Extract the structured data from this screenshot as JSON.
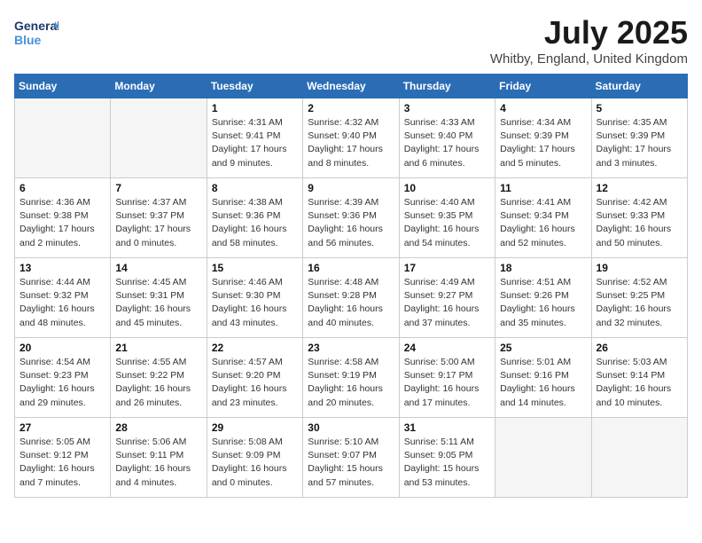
{
  "logo": {
    "line1": "General",
    "line2": "Blue"
  },
  "title": "July 2025",
  "location": "Whitby, England, United Kingdom",
  "weekdays": [
    "Sunday",
    "Monday",
    "Tuesday",
    "Wednesday",
    "Thursday",
    "Friday",
    "Saturday"
  ],
  "weeks": [
    [
      {
        "day": "",
        "info": ""
      },
      {
        "day": "",
        "info": ""
      },
      {
        "day": "1",
        "info": "Sunrise: 4:31 AM\nSunset: 9:41 PM\nDaylight: 17 hours and 9 minutes."
      },
      {
        "day": "2",
        "info": "Sunrise: 4:32 AM\nSunset: 9:40 PM\nDaylight: 17 hours and 8 minutes."
      },
      {
        "day": "3",
        "info": "Sunrise: 4:33 AM\nSunset: 9:40 PM\nDaylight: 17 hours and 6 minutes."
      },
      {
        "day": "4",
        "info": "Sunrise: 4:34 AM\nSunset: 9:39 PM\nDaylight: 17 hours and 5 minutes."
      },
      {
        "day": "5",
        "info": "Sunrise: 4:35 AM\nSunset: 9:39 PM\nDaylight: 17 hours and 3 minutes."
      }
    ],
    [
      {
        "day": "6",
        "info": "Sunrise: 4:36 AM\nSunset: 9:38 PM\nDaylight: 17 hours and 2 minutes."
      },
      {
        "day": "7",
        "info": "Sunrise: 4:37 AM\nSunset: 9:37 PM\nDaylight: 17 hours and 0 minutes."
      },
      {
        "day": "8",
        "info": "Sunrise: 4:38 AM\nSunset: 9:36 PM\nDaylight: 16 hours and 58 minutes."
      },
      {
        "day": "9",
        "info": "Sunrise: 4:39 AM\nSunset: 9:36 PM\nDaylight: 16 hours and 56 minutes."
      },
      {
        "day": "10",
        "info": "Sunrise: 4:40 AM\nSunset: 9:35 PM\nDaylight: 16 hours and 54 minutes."
      },
      {
        "day": "11",
        "info": "Sunrise: 4:41 AM\nSunset: 9:34 PM\nDaylight: 16 hours and 52 minutes."
      },
      {
        "day": "12",
        "info": "Sunrise: 4:42 AM\nSunset: 9:33 PM\nDaylight: 16 hours and 50 minutes."
      }
    ],
    [
      {
        "day": "13",
        "info": "Sunrise: 4:44 AM\nSunset: 9:32 PM\nDaylight: 16 hours and 48 minutes."
      },
      {
        "day": "14",
        "info": "Sunrise: 4:45 AM\nSunset: 9:31 PM\nDaylight: 16 hours and 45 minutes."
      },
      {
        "day": "15",
        "info": "Sunrise: 4:46 AM\nSunset: 9:30 PM\nDaylight: 16 hours and 43 minutes."
      },
      {
        "day": "16",
        "info": "Sunrise: 4:48 AM\nSunset: 9:28 PM\nDaylight: 16 hours and 40 minutes."
      },
      {
        "day": "17",
        "info": "Sunrise: 4:49 AM\nSunset: 9:27 PM\nDaylight: 16 hours and 37 minutes."
      },
      {
        "day": "18",
        "info": "Sunrise: 4:51 AM\nSunset: 9:26 PM\nDaylight: 16 hours and 35 minutes."
      },
      {
        "day": "19",
        "info": "Sunrise: 4:52 AM\nSunset: 9:25 PM\nDaylight: 16 hours and 32 minutes."
      }
    ],
    [
      {
        "day": "20",
        "info": "Sunrise: 4:54 AM\nSunset: 9:23 PM\nDaylight: 16 hours and 29 minutes."
      },
      {
        "day": "21",
        "info": "Sunrise: 4:55 AM\nSunset: 9:22 PM\nDaylight: 16 hours and 26 minutes."
      },
      {
        "day": "22",
        "info": "Sunrise: 4:57 AM\nSunset: 9:20 PM\nDaylight: 16 hours and 23 minutes."
      },
      {
        "day": "23",
        "info": "Sunrise: 4:58 AM\nSunset: 9:19 PM\nDaylight: 16 hours and 20 minutes."
      },
      {
        "day": "24",
        "info": "Sunrise: 5:00 AM\nSunset: 9:17 PM\nDaylight: 16 hours and 17 minutes."
      },
      {
        "day": "25",
        "info": "Sunrise: 5:01 AM\nSunset: 9:16 PM\nDaylight: 16 hours and 14 minutes."
      },
      {
        "day": "26",
        "info": "Sunrise: 5:03 AM\nSunset: 9:14 PM\nDaylight: 16 hours and 10 minutes."
      }
    ],
    [
      {
        "day": "27",
        "info": "Sunrise: 5:05 AM\nSunset: 9:12 PM\nDaylight: 16 hours and 7 minutes."
      },
      {
        "day": "28",
        "info": "Sunrise: 5:06 AM\nSunset: 9:11 PM\nDaylight: 16 hours and 4 minutes."
      },
      {
        "day": "29",
        "info": "Sunrise: 5:08 AM\nSunset: 9:09 PM\nDaylight: 16 hours and 0 minutes."
      },
      {
        "day": "30",
        "info": "Sunrise: 5:10 AM\nSunset: 9:07 PM\nDaylight: 15 hours and 57 minutes."
      },
      {
        "day": "31",
        "info": "Sunrise: 5:11 AM\nSunset: 9:05 PM\nDaylight: 15 hours and 53 minutes."
      },
      {
        "day": "",
        "info": ""
      },
      {
        "day": "",
        "info": ""
      }
    ]
  ]
}
